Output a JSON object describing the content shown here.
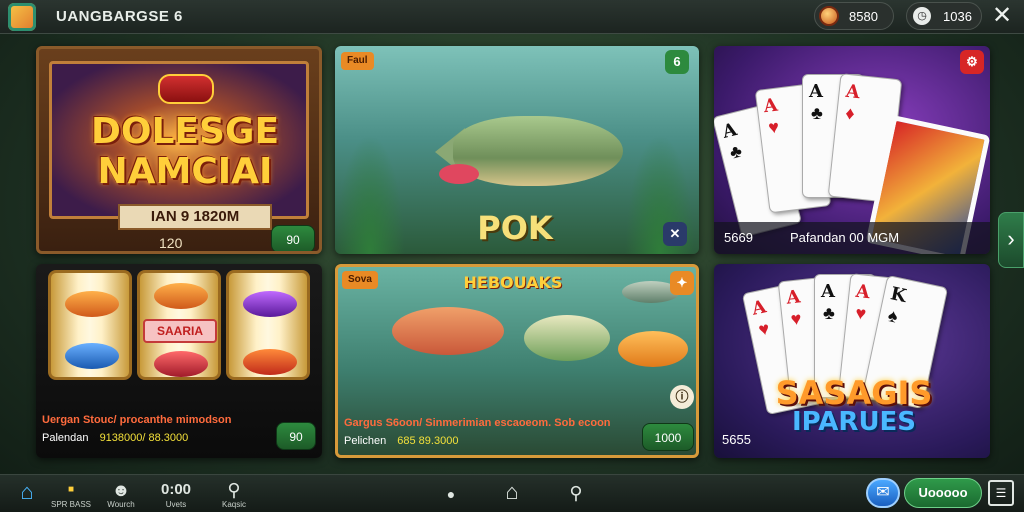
{
  "header": {
    "app_title": "UANGBARGSE 6",
    "coins": "8580",
    "time": "1036",
    "close_icon": "close-icon"
  },
  "cards": {
    "card1": {
      "title_line1": "DOLESGE",
      "title_line2": "NAMCIAI",
      "subtitle": "IAN 9 1820M",
      "score": "120",
      "button": "90"
    },
    "card2": {
      "tag": "Faul",
      "badge": "6",
      "title": "POK"
    },
    "card3": {
      "bottom_left": "5669",
      "bottom_right": "Pafandan 00 MGM"
    },
    "card4": {
      "center_label": "SAARIA",
      "line1": "Uergan Stouc/ procanthe mimodson",
      "line2_label": "Palendan",
      "line2_value": "9138000/ 88.3000",
      "button": "90"
    },
    "card5": {
      "tag": "Sova",
      "title": "HEBOUAKS",
      "line1": "Gargus S6oon/ Sinmerimian escaoeom. Sob ecoon",
      "line2_label": "Pelichen",
      "line2_value": "685 89.3000",
      "button": "1000"
    },
    "card6": {
      "title_line1": "SASAGIS",
      "title_line2": "IPARUES",
      "corner": "5655"
    }
  },
  "bottom_nav": {
    "items": [
      {
        "label": "",
        "icon": "home-icon"
      },
      {
        "label": "SPR BASS",
        "icon": ""
      },
      {
        "label": "Wourch",
        "icon": "avatar-icon"
      },
      {
        "label": "Uvets",
        "icon": ""
      },
      {
        "label": "Kaqsic",
        "icon": "location-icon"
      }
    ],
    "clock_text": "0:00",
    "user_button": "Uooooo"
  },
  "colors": {
    "accent_green": "#2d8a3e",
    "gold": "#ffcf3a",
    "orange": "#e98a25"
  }
}
